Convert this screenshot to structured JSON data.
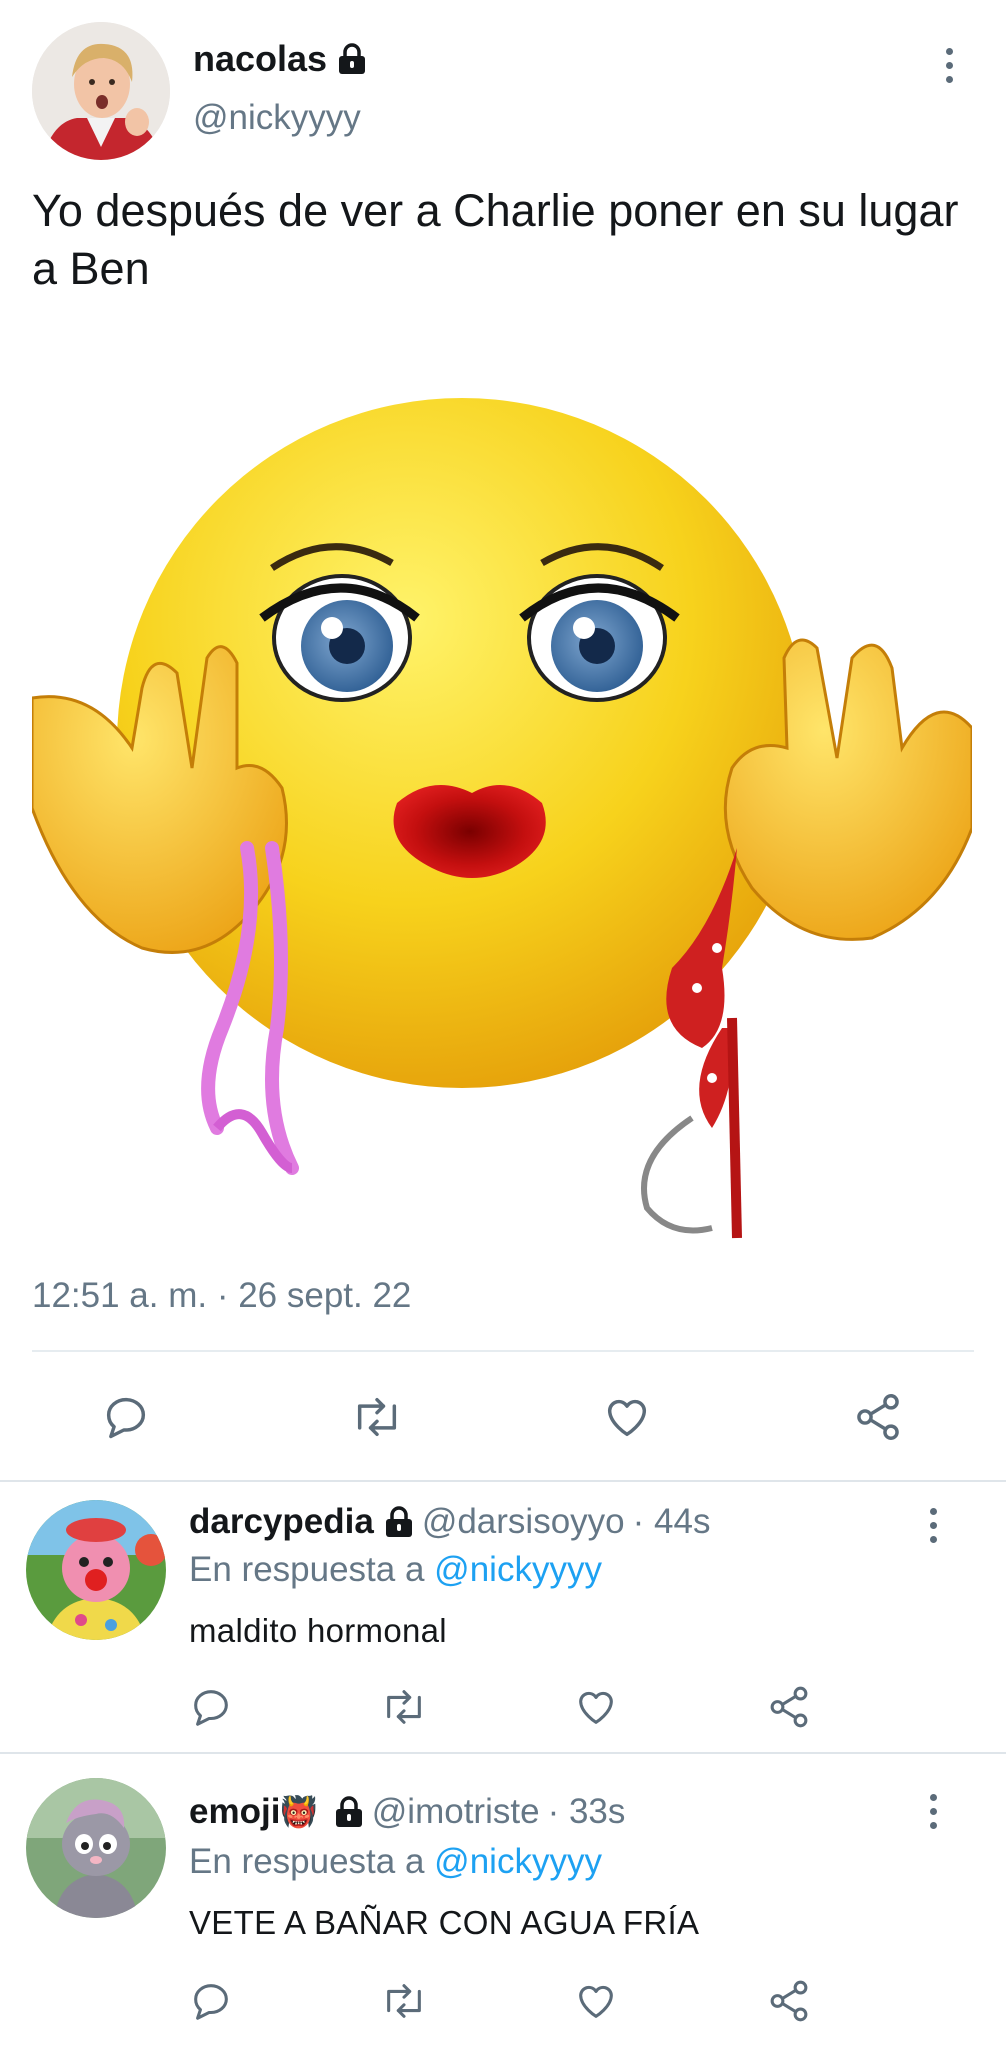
{
  "tweet": {
    "author_name": "nacolas",
    "author_handle": "@nickyyyy",
    "text": "Yo después de ver a Charlie poner en su lugar a Ben",
    "timestamp": "12:51 a. m. · 26 sept. 22"
  },
  "replies": [
    {
      "name": "darcypedia",
      "handle": "@darsisoyyo",
      "time": "· 44s",
      "reply_to_prefix": "En respuesta a",
      "reply_to_handle": "@nickyyyy",
      "text": "maldito hormonal"
    },
    {
      "name": "emoji",
      "emoji": "👹",
      "handle": "@imotriste",
      "time": "· 33s",
      "reply_to_prefix": "En respuesta a",
      "reply_to_handle": "@nickyyyy",
      "text": "VETE A BAÑAR CON AGUA FRÍA"
    }
  ],
  "colors": {
    "secondary_text": "#657786",
    "mention": "#1da1f2",
    "icon": "#5b6b79"
  },
  "icons": [
    "lock-icon",
    "more-icon",
    "reply-icon",
    "retweet-icon",
    "like-icon",
    "share-icon"
  ]
}
